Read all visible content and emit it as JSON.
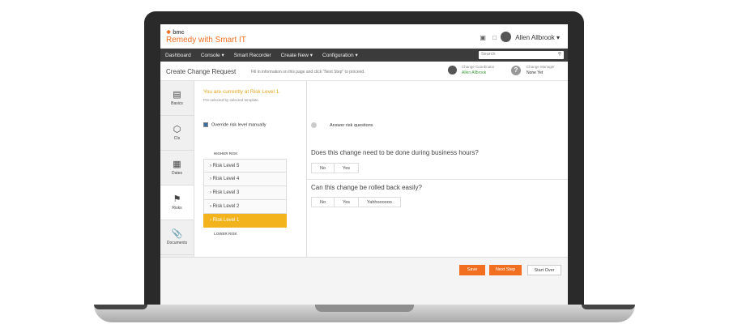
{
  "app": {
    "brand": "bmc",
    "title": "Remedy with Smart IT"
  },
  "header": {
    "user_name": "Allen Allbrook ▾"
  },
  "nav": {
    "items": [
      "Dashboard",
      "Console ▾",
      "Smart Recorder",
      "Create New ▾",
      "Configuration ▾"
    ],
    "search_placeholder": "Search"
  },
  "page": {
    "title": "Create Change Request",
    "instructions": "Fill in information on this page and click \"Next Step\" to proceed.",
    "coordinator_label": "Change Coordinator",
    "coordinator_value": "Allen Allbrook",
    "manager_label": "Change Manager",
    "manager_value": "None Yet"
  },
  "steps": [
    {
      "label": "Basics",
      "icon": "document-icon"
    },
    {
      "label": "CIs",
      "icon": "cube-icon"
    },
    {
      "label": "Dates",
      "icon": "calendar-icon"
    },
    {
      "label": "Risks",
      "icon": "flag-icon"
    },
    {
      "label": "Documents",
      "icon": "paperclip-icon"
    }
  ],
  "risk": {
    "note": "You are currently at Risk Level 1.",
    "sub": "Pre-selected by selected template.",
    "override_label": "Override risk level manually",
    "higher": "HIGHER RISK",
    "lower": "LOWER RISK",
    "levels": [
      "Risk Level 5",
      "Risk Level 4",
      "Risk Level 3",
      "Risk Level 2",
      "Risk Level 1"
    ],
    "selected_level": "Risk Level 1"
  },
  "questions": {
    "answer_label": "Answer risk questions",
    "q1": {
      "text": "Does this change need to be done during business hours?",
      "options": [
        "No",
        "Yes"
      ]
    },
    "q2": {
      "text": "Can this change be rolled back easily?",
      "options": [
        "No",
        "Yes",
        "Yahhoooooo"
      ]
    }
  },
  "footer": {
    "save": "Save",
    "next": "Next Step",
    "start_over": "Start Over"
  },
  "colors": {
    "brand_orange": "#f26e21",
    "risk_selected": "#f2b31d",
    "navbar": "#3b3b3b"
  }
}
